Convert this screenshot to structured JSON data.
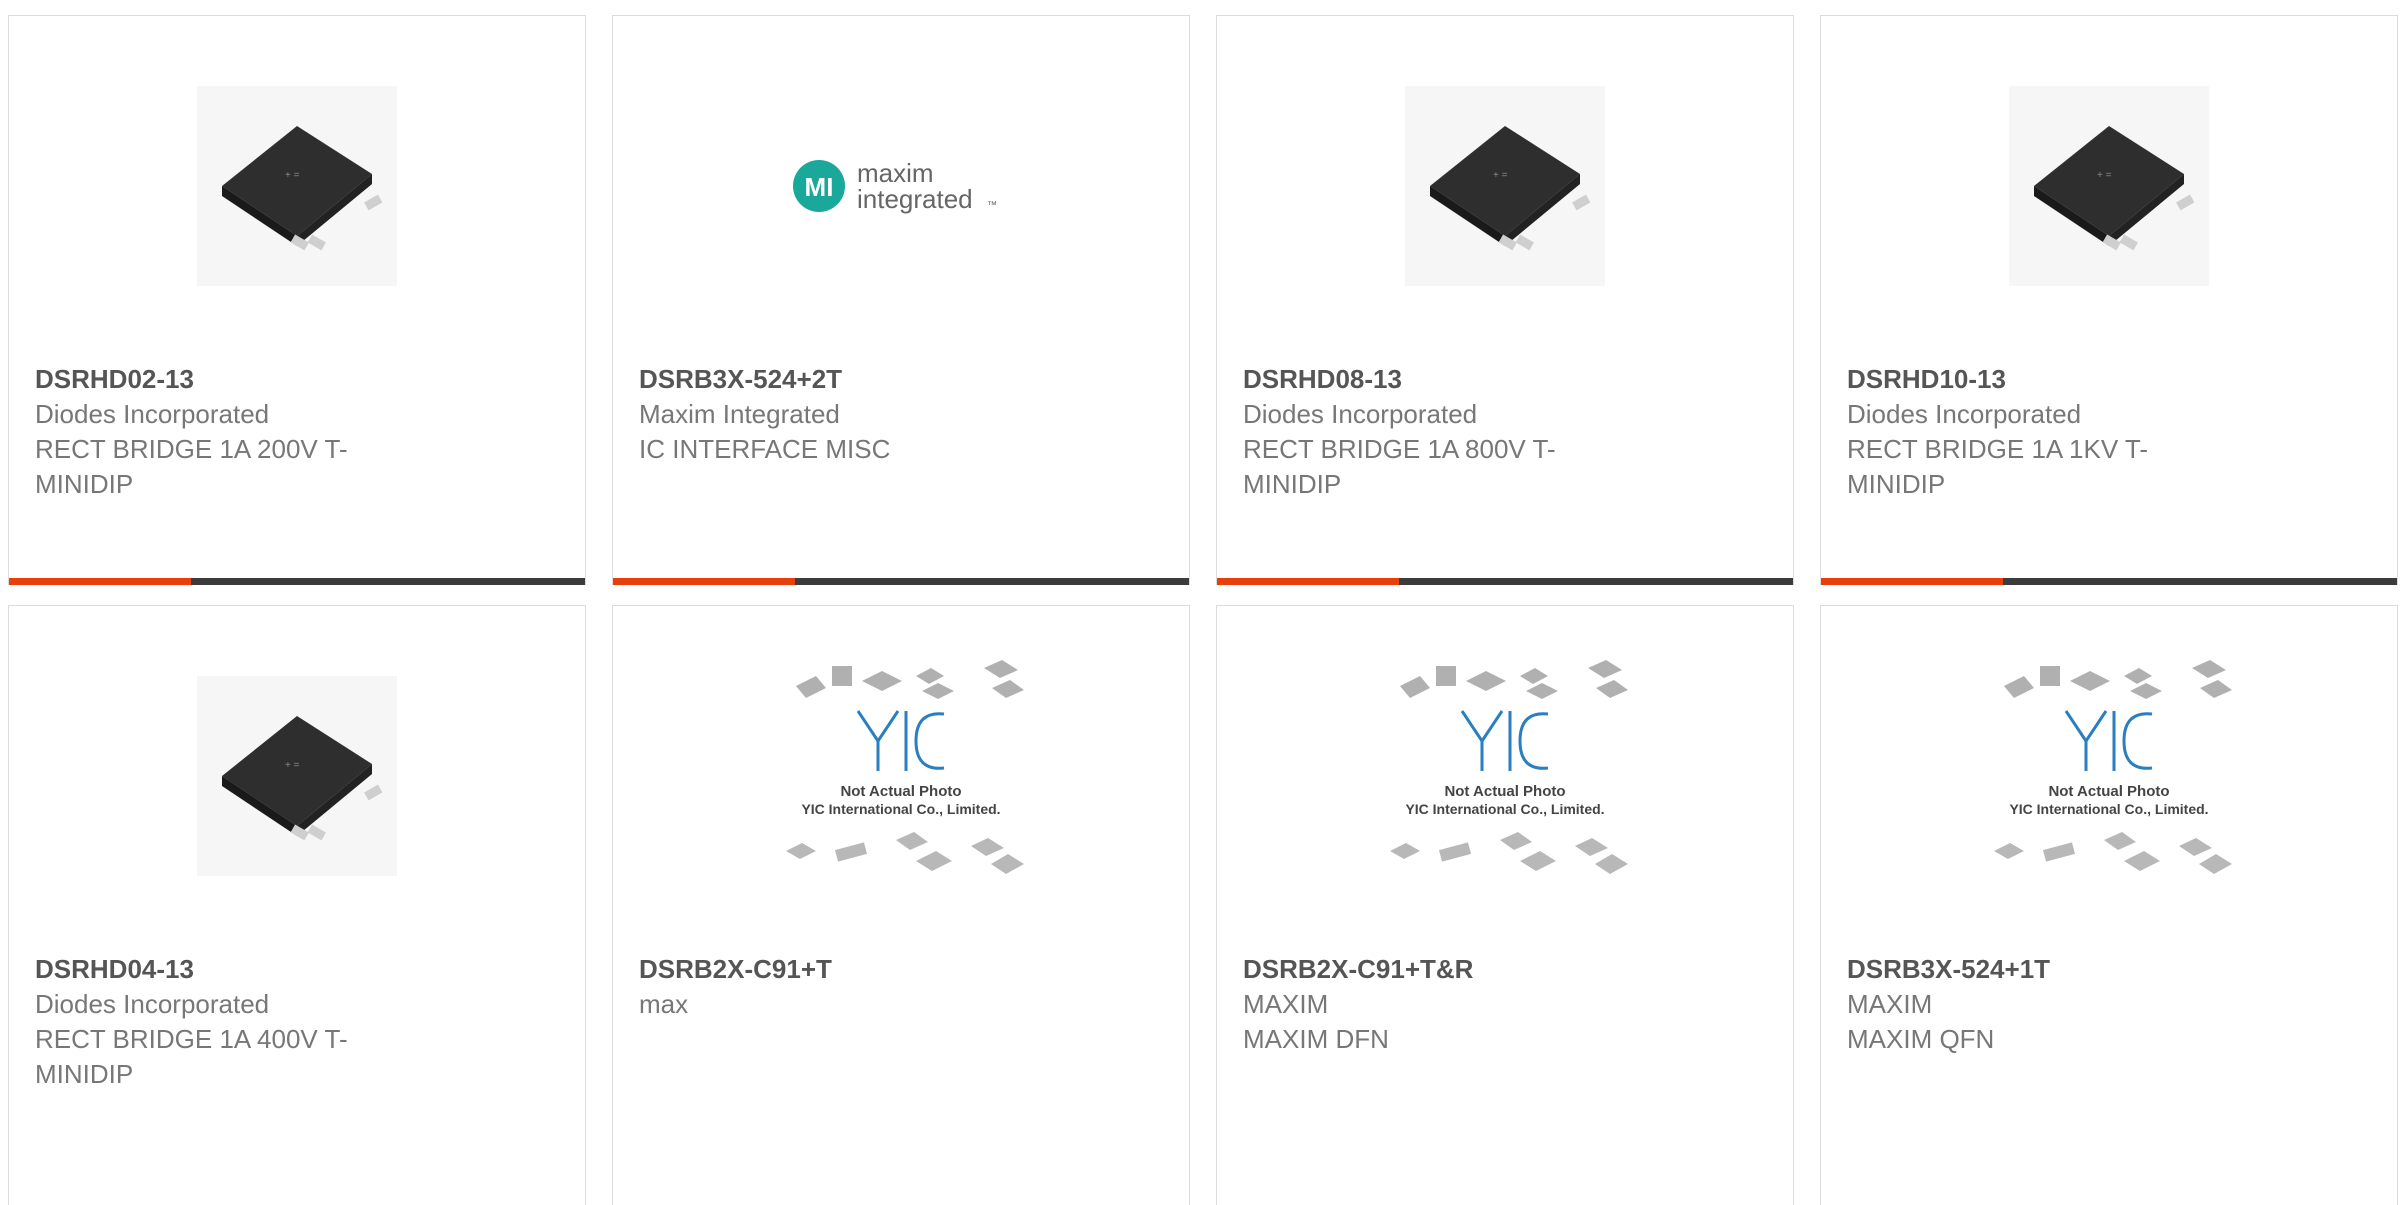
{
  "products": [
    {
      "part_number": "DSRHD02-13",
      "manufacturer": "Diodes Incorporated",
      "description": "RECT BRIDGE 1A 200V T-MINIDIP",
      "image": "bridge-rectifier-chip"
    },
    {
      "part_number": "DSRB3X-524+2T",
      "manufacturer": "Maxim Integrated",
      "description": "IC INTERFACE MISC",
      "image": "maxim-integrated-logo",
      "logo_line1": "maxim",
      "logo_line2": "integrated",
      "logo_tm": "™"
    },
    {
      "part_number": "DSRHD08-13",
      "manufacturer": "Diodes Incorporated",
      "description": "RECT BRIDGE 1A 800V T-MINIDIP",
      "image": "bridge-rectifier-chip"
    },
    {
      "part_number": "DSRHD10-13",
      "manufacturer": "Diodes Incorporated",
      "description": "RECT BRIDGE 1A 1KV T-MINIDIP",
      "image": "bridge-rectifier-chip"
    },
    {
      "part_number": "DSRHD04-13",
      "manufacturer": "Diodes Incorporated",
      "description": "RECT BRIDGE 1A 400V T-MINIDIP",
      "image": "bridge-rectifier-chip"
    },
    {
      "part_number": "DSRB2X-C91+T",
      "manufacturer": "max",
      "description": "",
      "image": "yic-placeholder",
      "ph_line1": "Not Actual Photo",
      "ph_line2": "YIC International Co., Limited."
    },
    {
      "part_number": "DSRB2X-C91+T&R",
      "manufacturer": "MAXIM",
      "description": "MAXIM DFN",
      "image": "yic-placeholder",
      "ph_line1": "Not Actual Photo",
      "ph_line2": "YIC International Co., Limited."
    },
    {
      "part_number": "DSRB3X-524+1T",
      "manufacturer": "MAXIM",
      "description": "MAXIM QFN",
      "image": "yic-placeholder",
      "ph_line1": "Not Actual Photo",
      "ph_line2": "YIC International Co., Limited."
    }
  ],
  "colors": {
    "accent": "#e8400c",
    "bar": "#3c3c3c",
    "maxim_teal": "#1aa89a",
    "yic_blue": "#2a7fc1"
  }
}
